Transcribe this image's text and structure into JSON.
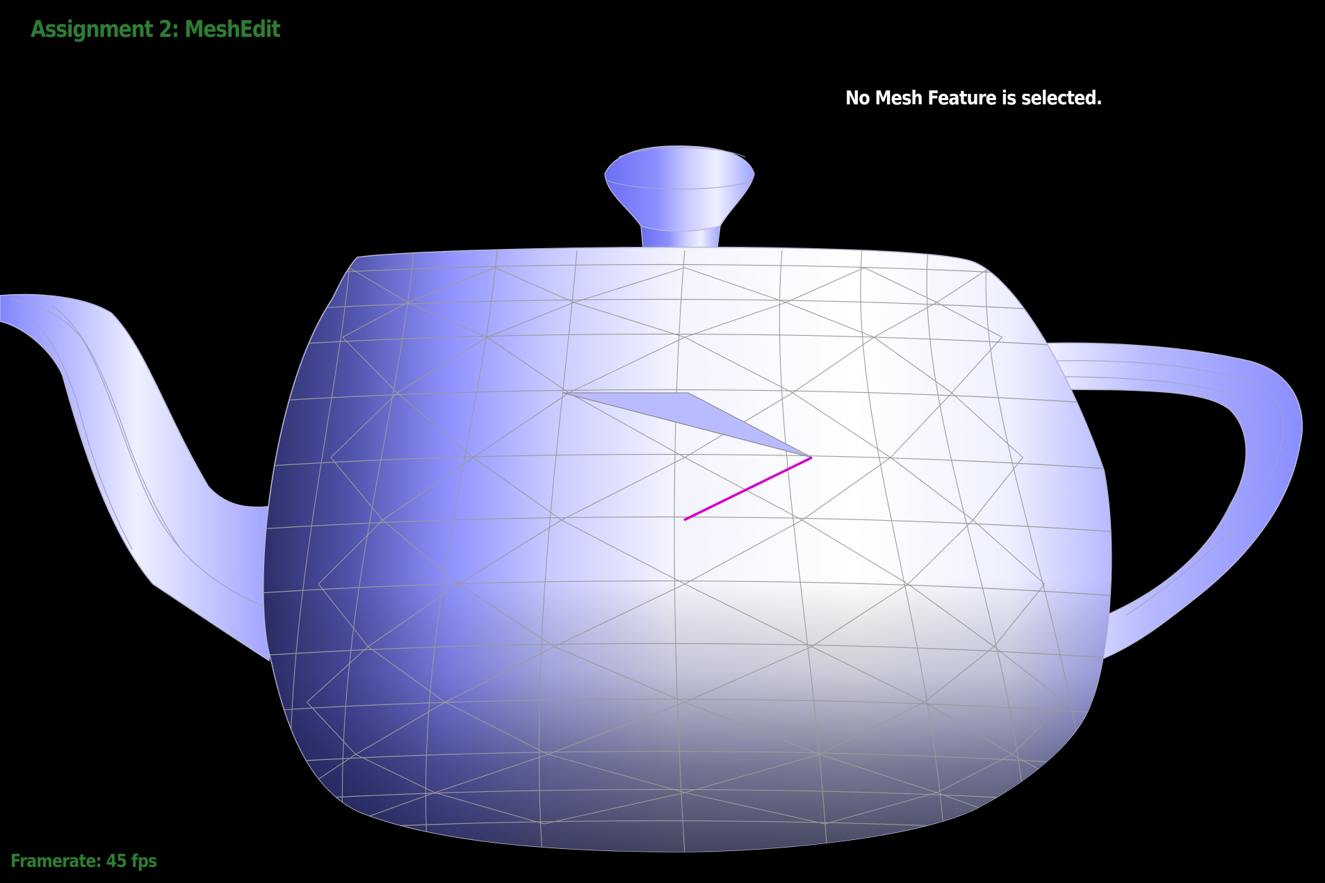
{
  "app": {
    "title": "Assignment 2: MeshEdit",
    "selection_status": "No Mesh Feature is selected.",
    "framerate": "Framerate: 45 fps"
  },
  "colors": {
    "background": "#000000",
    "hud_title": "#2e7d32",
    "hud_status": "#ffffff",
    "hud_framerate": "#2e7d32",
    "mesh_base": "#8a8cff",
    "mesh_highlight": "#ffffff",
    "mesh_edge": "#9a9a9a",
    "mesh_outline": "#b7b7d6",
    "selected_edge": "#d400c8"
  },
  "scene": {
    "model": "teapot-mesh",
    "highlighted_element": "magenta-edge"
  }
}
